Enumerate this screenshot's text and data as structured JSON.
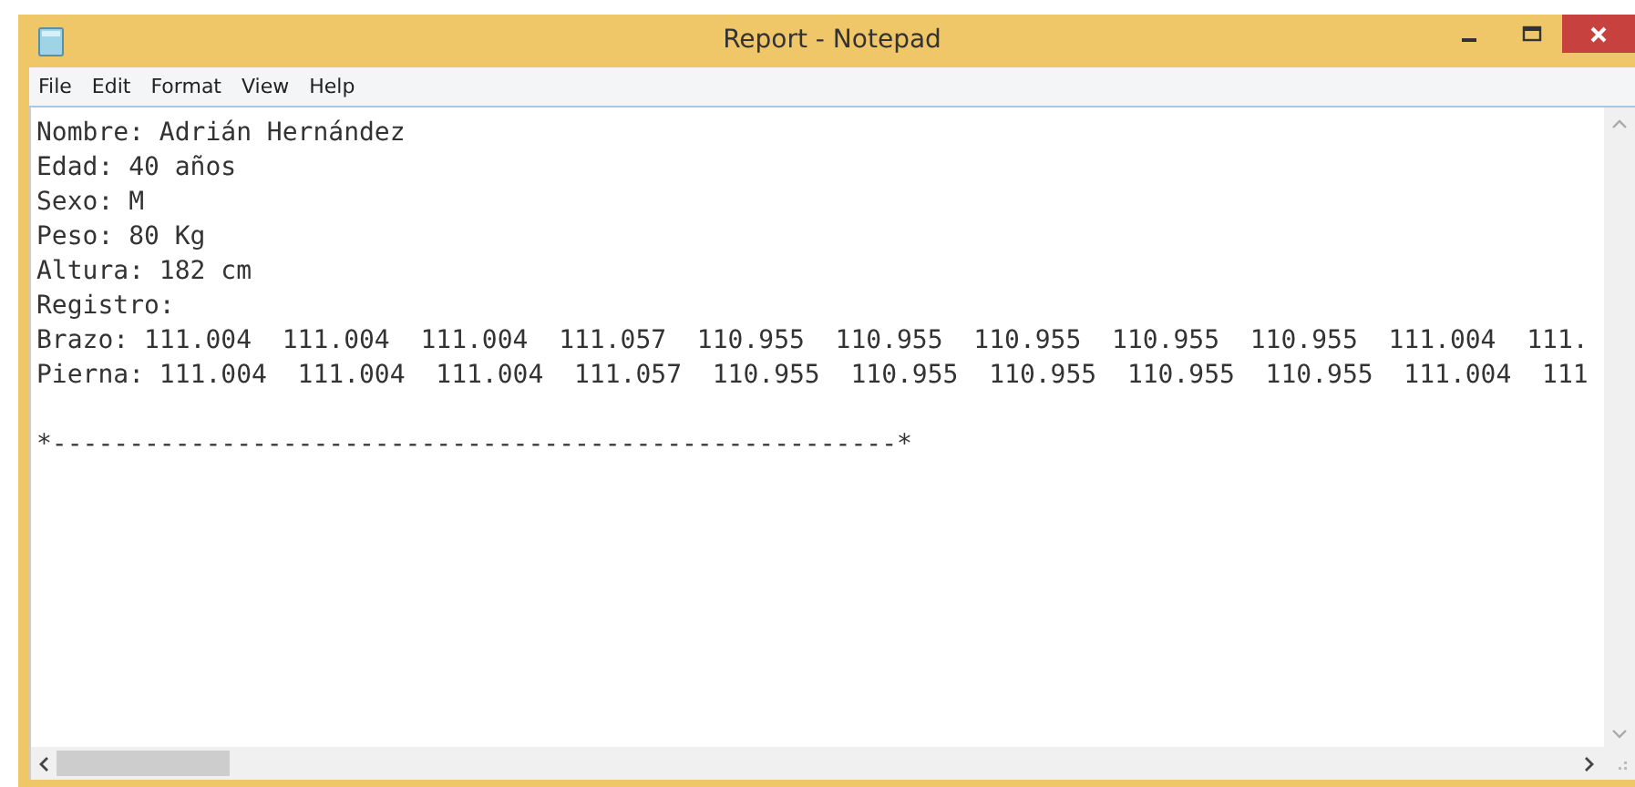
{
  "window": {
    "title": "Report - Notepad"
  },
  "menu": [
    "File",
    "Edit",
    "Format",
    "View",
    "Help"
  ],
  "lines": [
    "Nombre: Adrián Hernández",
    "Edad: 40 años",
    "Sexo: M",
    "Peso: 80 Kg",
    "Altura: 182 cm",
    "Registro:",
    "Brazo: 111.004  111.004  111.004  111.057  110.955  110.955  110.955  110.955  110.955  111.004  111.",
    "Pierna: 111.004  111.004  111.004  111.057  110.955  110.955  110.955  110.955  110.955  111.004  111"
  ],
  "separator": "*-------------------------------------------------------*"
}
